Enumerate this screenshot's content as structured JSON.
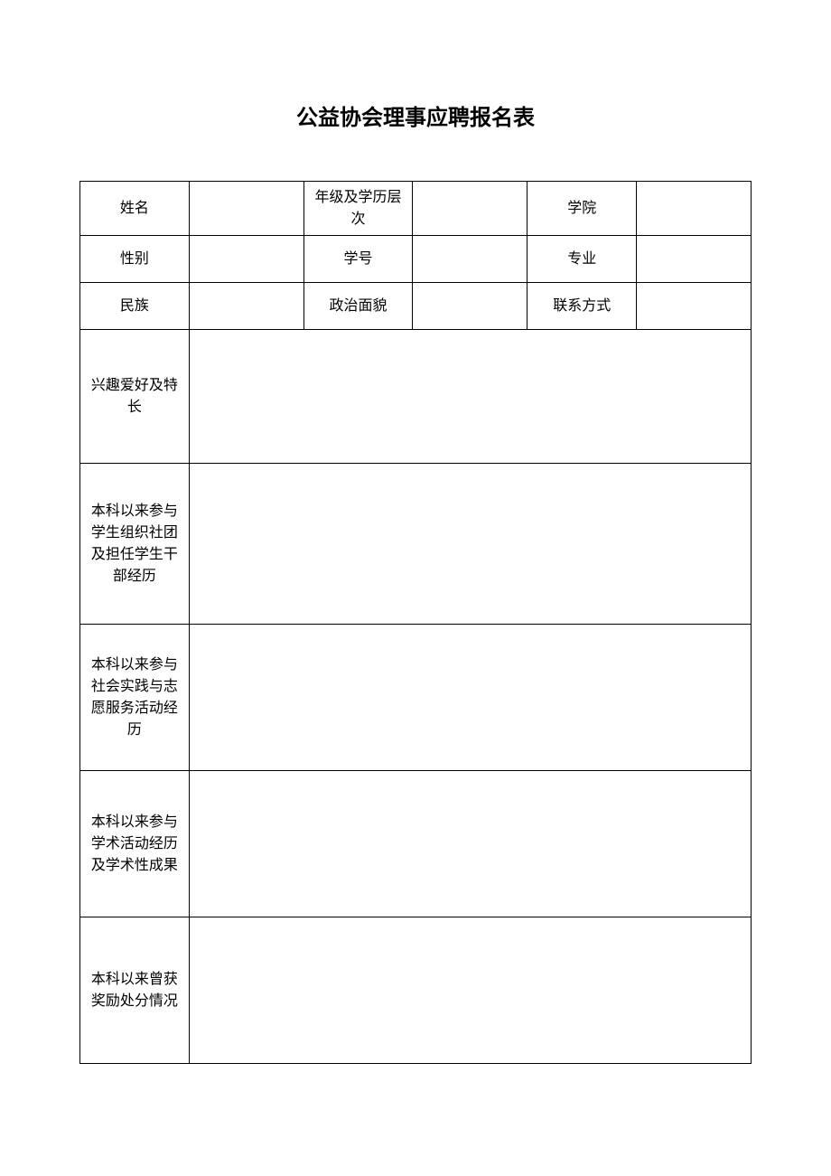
{
  "title": "公益协会理事应聘报名表",
  "rows": {
    "r1": {
      "label1": "姓名",
      "value1": "",
      "label2": "年级及学历层次",
      "value2": "",
      "label3": "学院",
      "value3": ""
    },
    "r2": {
      "label1": "性别",
      "value1": "",
      "label2": "学号",
      "value2": "",
      "label3": "专业",
      "value3": ""
    },
    "r3": {
      "label1": "民族",
      "value1": "",
      "label2": "政治面貌",
      "value2": "",
      "label3": "联系方式",
      "value3": ""
    },
    "r4": {
      "label": "兴趣爱好及特长",
      "value": ""
    },
    "r5": {
      "label": "本科以来参与学生组织社团及担任学生干部经历",
      "value": ""
    },
    "r6": {
      "label": "本科以来参与社会实践与志愿服务活动经历",
      "value": ""
    },
    "r7": {
      "label": "本科以来参与学术活动经历及学术性成果",
      "value": ""
    },
    "r8": {
      "label": "本科以来曾获奖励处分情况",
      "value": ""
    }
  }
}
